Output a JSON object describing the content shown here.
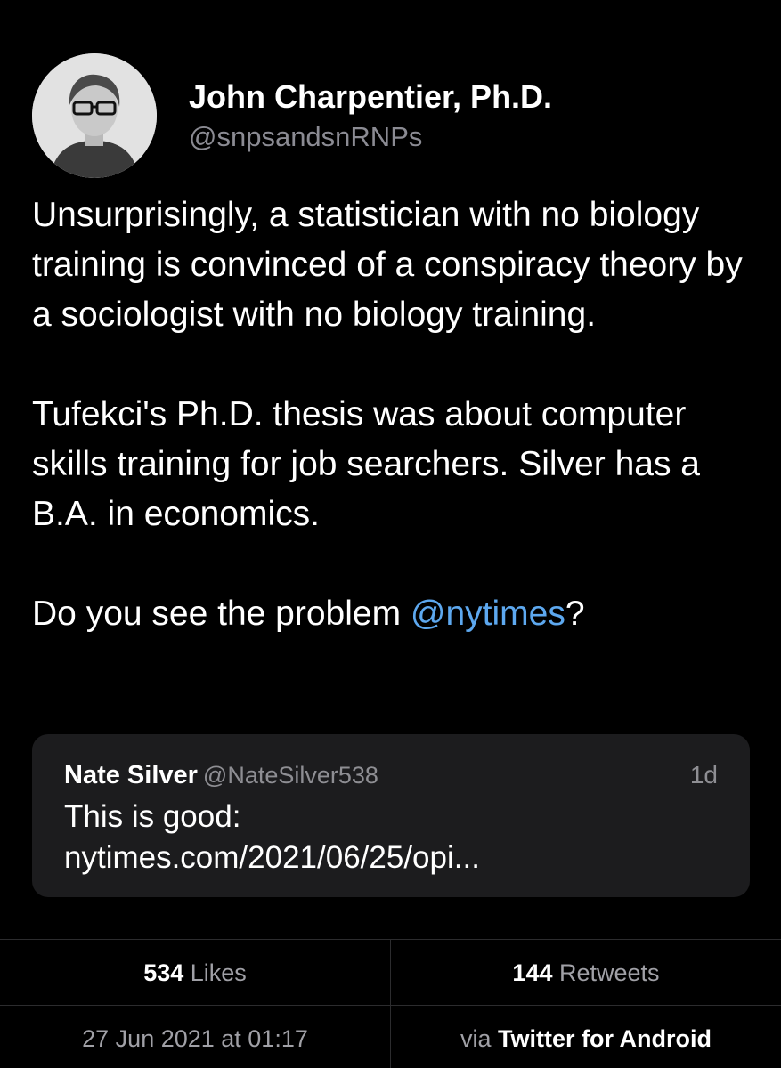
{
  "author": {
    "display_name": "John Charpentier, Ph.D.",
    "handle": "@snpsandsnRNPs",
    "avatar": "avatar-photo"
  },
  "tweet": {
    "paragraphs": [
      "Unsurprisingly, a statistician with no biology training is convinced of a conspiracy theory by a sociologist with no biology training.",
      "Tufekci's Ph.D. thesis was about computer skills training for job searchers. Silver has a B.A. in economics."
    ],
    "last_prefix": "Do you see the problem ",
    "mention": "@nytimes",
    "last_suffix": "?"
  },
  "quoted_tweet": {
    "name": "Nate Silver",
    "handle": "@NateSilver538",
    "time": "1d",
    "text_line1": "This is good:",
    "text_line2": "nytimes.com/2021/06/25/opi..."
  },
  "stats": {
    "likes_count": "534",
    "likes_label": "Likes",
    "retweets_count": "144",
    "retweets_label": "Retweets"
  },
  "meta": {
    "timestamp": "27 Jun 2021 at 01:17",
    "via_prefix": "via",
    "client": "Twitter for Android"
  },
  "colors": {
    "background": "#000000",
    "link": "#5da8ef",
    "quote_bg": "#1c1c1e",
    "muted": "#8e8e93"
  }
}
